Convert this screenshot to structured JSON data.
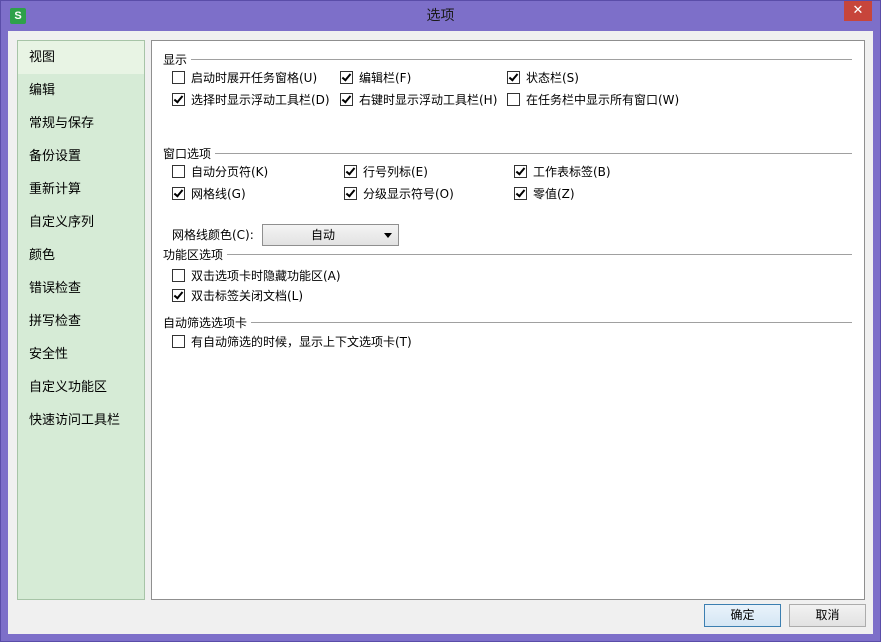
{
  "window": {
    "title": "选项",
    "app_icon_letter": "S",
    "close_label": "✕"
  },
  "sidebar": {
    "items": [
      {
        "label": "视图"
      },
      {
        "label": "编辑"
      },
      {
        "label": "常规与保存"
      },
      {
        "label": "备份设置"
      },
      {
        "label": "重新计算"
      },
      {
        "label": "自定义序列"
      },
      {
        "label": "颜色"
      },
      {
        "label": "错误检查"
      },
      {
        "label": "拼写检查"
      },
      {
        "label": "安全性"
      },
      {
        "label": "自定义功能区"
      },
      {
        "label": "快速访问工具栏"
      }
    ],
    "selected": "视图"
  },
  "display": {
    "title": "显示",
    "options": [
      {
        "label": "启动时展开任务窗格(U)",
        "checked": false
      },
      {
        "label": "编辑栏(F)",
        "checked": true
      },
      {
        "label": "状态栏(S)",
        "checked": true
      },
      {
        "label": "选择时显示浮动工具栏(D)",
        "checked": true
      },
      {
        "label": "右键时显示浮动工具栏(H)",
        "checked": true
      },
      {
        "label": "在任务栏中显示所有窗口(W)",
        "checked": false
      }
    ]
  },
  "window_options": {
    "title": "窗口选项",
    "options": [
      {
        "label": "自动分页符(K)",
        "checked": false
      },
      {
        "label": "行号列标(E)",
        "checked": true
      },
      {
        "label": "工作表标签(B)",
        "checked": true
      },
      {
        "label": "网格线(G)",
        "checked": true
      },
      {
        "label": "分级显示符号(O)",
        "checked": true
      },
      {
        "label": "零值(Z)",
        "checked": true
      }
    ],
    "gridline_color_label": "网格线颜色(C):",
    "gridline_color_value": "自动"
  },
  "ribbon_options": {
    "title": "功能区选项",
    "options": [
      {
        "label": "双击选项卡时隐藏功能区(A)",
        "checked": false
      },
      {
        "label": "双击标签关闭文档(L)",
        "checked": true
      }
    ]
  },
  "autofilter": {
    "title": "自动筛选选项卡",
    "options": [
      {
        "label": "有自动筛选的时候，显示上下文选项卡(T)",
        "checked": false
      }
    ]
  },
  "footer": {
    "ok_label": "确定",
    "cancel_label": "取消"
  }
}
